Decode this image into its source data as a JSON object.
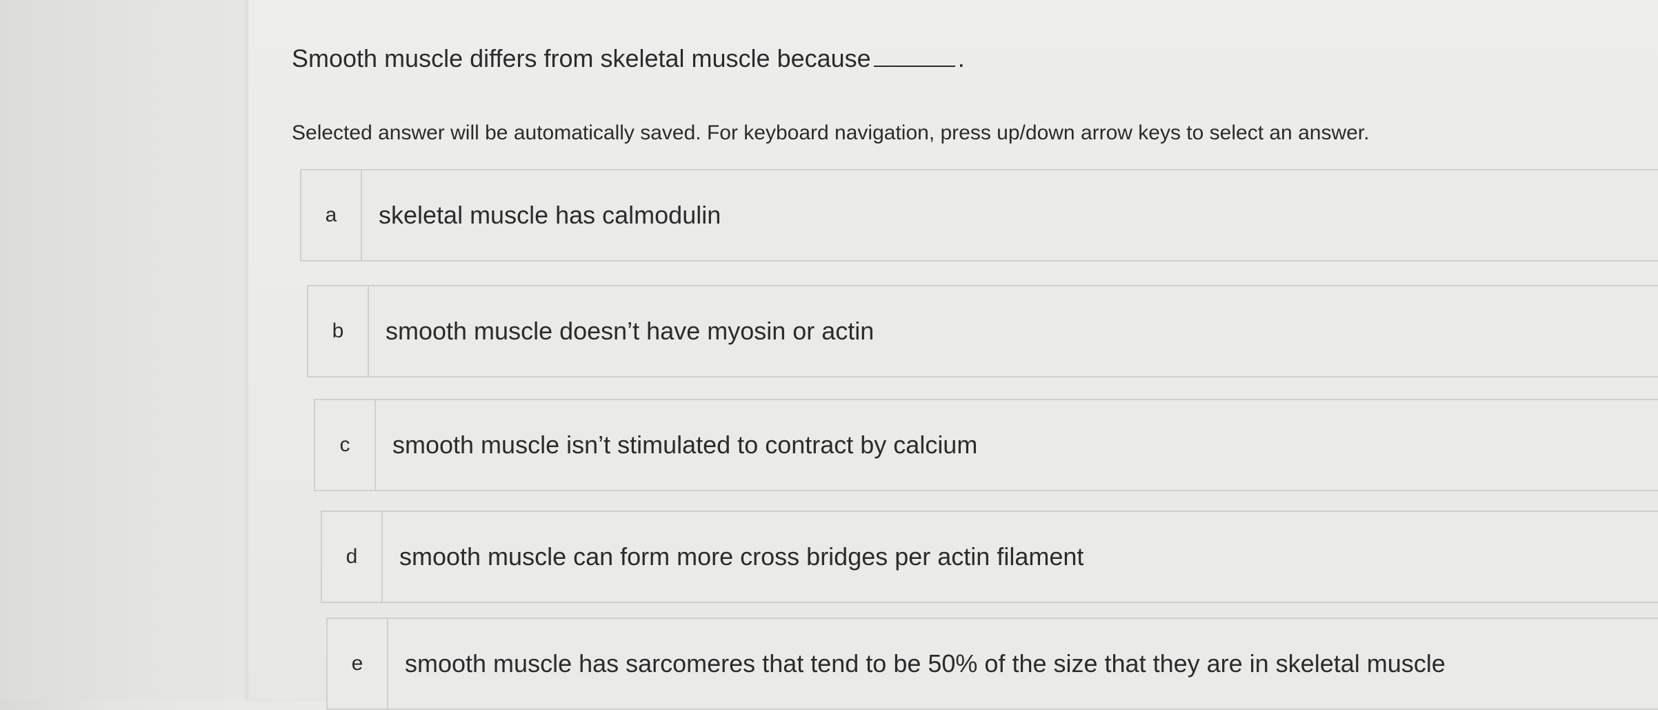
{
  "question": {
    "text": "Smooth muscle differs from skeletal muscle because",
    "period": "."
  },
  "instructions": "Selected answer will be automatically saved. For keyboard navigation, press up/down arrow keys to select an answer.",
  "options": [
    {
      "letter": "a",
      "text": "skeletal muscle has calmodulin"
    },
    {
      "letter": "b",
      "text": "smooth muscle doesn’t have myosin or actin"
    },
    {
      "letter": "c",
      "text": "smooth muscle isn’t stimulated to contract by calcium"
    },
    {
      "letter": "d",
      "text": "smooth muscle can form more cross bridges per actin filament"
    },
    {
      "letter": "e",
      "text": "smooth muscle has sarcomeres that tend to be 50% of the size that they are in skeletal muscle"
    }
  ]
}
